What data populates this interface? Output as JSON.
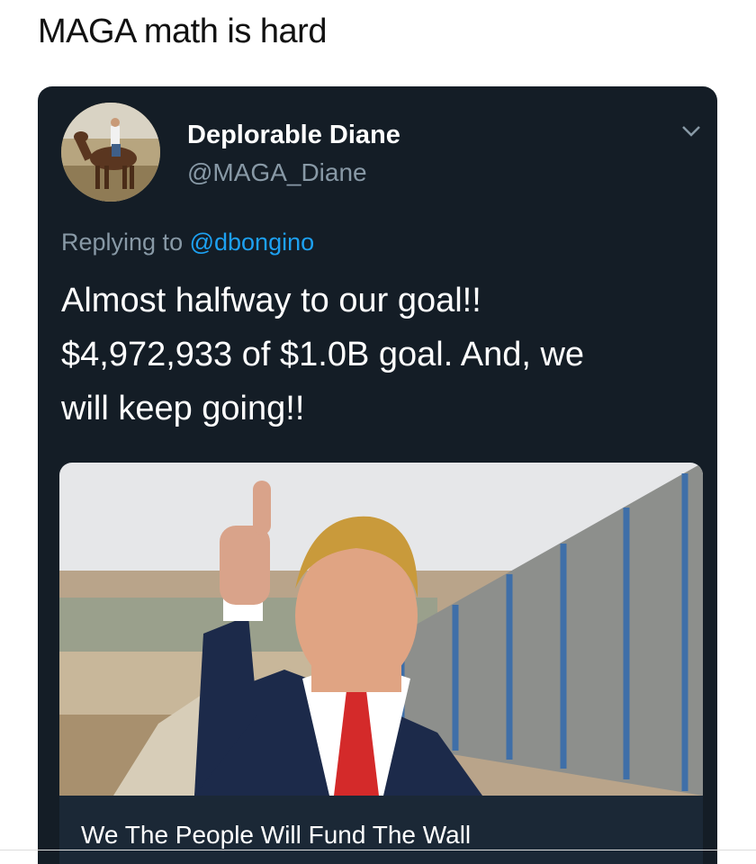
{
  "caption": "MAGA math is hard",
  "tweet": {
    "display_name": "Deplorable Diane",
    "handle": "@MAGA_Diane",
    "replying_prefix": "Replying to ",
    "replying_to": "@dbongino",
    "text": "Almost halfway to our goal!!\n$4,972,933 of $1.0B goal.  And, we\nwill keep going!!",
    "card_title": "We The People Will Fund The Wall"
  },
  "icons": {
    "menu": "chevron-down-icon"
  },
  "colors": {
    "tweet_background": "#141d26",
    "secondary_text": "#8899a6",
    "mention": "#1da1f2"
  }
}
